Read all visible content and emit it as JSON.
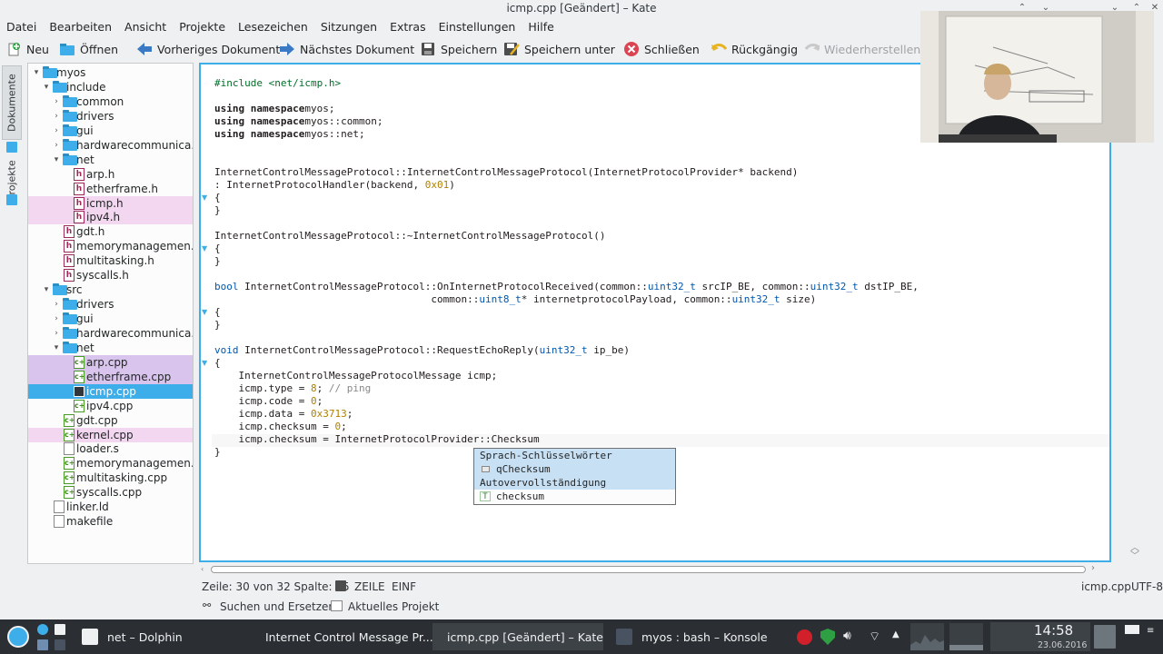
{
  "window": {
    "title": "icmp.cpp [Geändert] – Kate"
  },
  "menu": [
    "Datei",
    "Bearbeiten",
    "Ansicht",
    "Projekte",
    "Lesezeichen",
    "Sitzungen",
    "Extras",
    "Einstellungen",
    "Hilfe"
  ],
  "toolbar": {
    "new": "Neu",
    "open": "Öffnen",
    "prev_doc": "Vorheriges Dokument",
    "next_doc": "Nächstes Dokument",
    "save": "Speichern",
    "save_as": "Speichern unter",
    "close": "Schließen",
    "undo": "Rückgängig",
    "redo": "Wiederherstellen"
  },
  "side_tabs": {
    "documents": "Dokumente",
    "projects": "Projekte"
  },
  "tree": [
    {
      "label": "myos",
      "depth": 0,
      "type": "folder",
      "expanded": true
    },
    {
      "label": "include",
      "depth": 1,
      "type": "folder",
      "expanded": true
    },
    {
      "label": "common",
      "depth": 2,
      "type": "folder",
      "expanded": false
    },
    {
      "label": "drivers",
      "depth": 2,
      "type": "folder",
      "expanded": false
    },
    {
      "label": "gui",
      "depth": 2,
      "type": "folder",
      "expanded": false
    },
    {
      "label": "hardwarecommunica...",
      "depth": 2,
      "type": "folder",
      "expanded": false
    },
    {
      "label": "net",
      "depth": 2,
      "type": "folder",
      "expanded": true
    },
    {
      "label": "arp.h",
      "depth": 3,
      "type": "h",
      "hl": ""
    },
    {
      "label": "etherframe.h",
      "depth": 3,
      "type": "h",
      "hl": ""
    },
    {
      "label": "icmp.h",
      "depth": 3,
      "type": "h",
      "hl": "pink"
    },
    {
      "label": "ipv4.h",
      "depth": 3,
      "type": "h",
      "hl": "pink"
    },
    {
      "label": "gdt.h",
      "depth": 2,
      "type": "h",
      "hl": ""
    },
    {
      "label": "memorymanagemen...",
      "depth": 2,
      "type": "h",
      "hl": ""
    },
    {
      "label": "multitasking.h",
      "depth": 2,
      "type": "h",
      "hl": ""
    },
    {
      "label": "syscalls.h",
      "depth": 2,
      "type": "h",
      "hl": ""
    },
    {
      "label": "src",
      "depth": 1,
      "type": "folder",
      "expanded": true
    },
    {
      "label": "drivers",
      "depth": 2,
      "type": "folder",
      "expanded": false
    },
    {
      "label": "gui",
      "depth": 2,
      "type": "folder",
      "expanded": false
    },
    {
      "label": "hardwarecommunica...",
      "depth": 2,
      "type": "folder",
      "expanded": false
    },
    {
      "label": "net",
      "depth": 2,
      "type": "folder",
      "expanded": true
    },
    {
      "label": "arp.cpp",
      "depth": 3,
      "type": "cpp",
      "hl": "purple"
    },
    {
      "label": "etherframe.cpp",
      "depth": 3,
      "type": "cpp",
      "hl": "purple"
    },
    {
      "label": "icmp.cpp",
      "depth": 3,
      "type": "save",
      "hl": "selected"
    },
    {
      "label": "ipv4.cpp",
      "depth": 3,
      "type": "cpp",
      "hl": ""
    },
    {
      "label": "gdt.cpp",
      "depth": 2,
      "type": "cpp",
      "hl": ""
    },
    {
      "label": "kernel.cpp",
      "depth": 2,
      "type": "cpp",
      "hl": "pink"
    },
    {
      "label": "loader.s",
      "depth": 2,
      "type": "plain",
      "hl": ""
    },
    {
      "label": "memorymanagemen...",
      "depth": 2,
      "type": "cpp",
      "hl": ""
    },
    {
      "label": "multitasking.cpp",
      "depth": 2,
      "type": "cpp",
      "hl": ""
    },
    {
      "label": "syscalls.cpp",
      "depth": 2,
      "type": "cpp",
      "hl": ""
    },
    {
      "label": "linker.ld",
      "depth": 1,
      "type": "plain",
      "hl": ""
    },
    {
      "label": "makefile",
      "depth": 1,
      "type": "plain",
      "hl": ""
    }
  ],
  "code": [
    [
      [
        "pp",
        "#include <net/icmp.h>"
      ]
    ],
    [],
    [
      [
        "kw",
        "using namespace"
      ],
      [
        "",
        "myos;"
      ]
    ],
    [
      [
        "kw",
        "using namespace"
      ],
      [
        "",
        "myos::common;"
      ]
    ],
    [
      [
        "kw",
        "using namespace"
      ],
      [
        "",
        "myos::net;"
      ]
    ],
    [],
    [],
    [
      [
        "",
        "InternetControlMessageProtocol::InternetControlMessageProtocol(InternetProtocolProvider* backend)"
      ]
    ],
    [
      [
        "",
        ": InternetProtocolHandler(backend, "
      ],
      [
        "num",
        "0x01"
      ],
      [
        "",
        ")"
      ]
    ],
    [
      [
        "",
        "{"
      ]
    ],
    [
      [
        "",
        "}"
      ]
    ],
    [],
    [
      [
        "",
        "InternetControlMessageProtocol::~InternetControlMessageProtocol()"
      ]
    ],
    [
      [
        "",
        "{"
      ]
    ],
    [
      [
        "",
        "}"
      ]
    ],
    [],
    [
      [
        "ty",
        "bool"
      ],
      [
        "",
        " InternetControlMessageProtocol::OnInternetProtocolReceived(common::"
      ],
      [
        "ty",
        "uint32_t"
      ],
      [
        "",
        " srcIP_BE, common::"
      ],
      [
        "ty",
        "uint32_t"
      ],
      [
        "",
        " dstIP_BE,"
      ]
    ],
    [
      [
        "",
        "                                    common::"
      ],
      [
        "ty",
        "uint8_t"
      ],
      [
        "",
        "* internetprotocolPayload, common::"
      ],
      [
        "ty",
        "uint32_t"
      ],
      [
        "",
        " size)"
      ]
    ],
    [
      [
        "",
        "{"
      ]
    ],
    [
      [
        "",
        "}"
      ]
    ],
    [],
    [
      [
        "ty",
        "void"
      ],
      [
        "",
        " InternetControlMessageProtocol::RequestEchoReply("
      ],
      [
        "ty",
        "uint32_t"
      ],
      [
        "",
        " ip_be)"
      ]
    ],
    [
      [
        "",
        "{"
      ]
    ],
    [
      [
        "",
        "    InternetControlMessageProtocolMessage icmp;"
      ]
    ],
    [
      [
        "",
        "    icmp.type = "
      ],
      [
        "num",
        "8"
      ],
      [
        "",
        "; "
      ],
      [
        "cm",
        "// ping"
      ]
    ],
    [
      [
        "",
        "    icmp.code = "
      ],
      [
        "num",
        "0"
      ],
      [
        "",
        ";"
      ]
    ],
    [
      [
        "",
        "    icmp.data = "
      ],
      [
        "num",
        "0x3713"
      ],
      [
        "",
        ";"
      ]
    ],
    [
      [
        "",
        "    icmp.checksum = "
      ],
      [
        "num",
        "0"
      ],
      [
        "",
        ";"
      ]
    ],
    [
      [
        "",
        "    icmp.checksum = InternetProtocolProvider::Checksum"
      ]
    ],
    [
      [
        "",
        "}"
      ]
    ]
  ],
  "completion": {
    "group1": "Sprach-Schlüsselwörter",
    "item1": "qChecksum",
    "group2": "Autovervollständigung",
    "item2": "checksum"
  },
  "status": {
    "position": "Zeile: 30 von 32 Spalte: 55",
    "mode": "ZEILE",
    "insert": "EINF",
    "filename": "icmp.cpp",
    "encoding": "UTF-8"
  },
  "bottom_tabs": {
    "search": "Suchen und Ersetzen",
    "project": "Aktuelles Projekt"
  },
  "taskbar": {
    "tasks": [
      "net – Dolphin",
      "Internet Control Message Pr...",
      "icmp.cpp [Geändert] – Kate",
      "myos : bash – Konsole"
    ],
    "time": "14:58",
    "date": "23.06.2016"
  },
  "colors": {
    "accent": "#3daee9",
    "hl_pink": "#f3d6f0",
    "hl_purple": "#d9c4ee",
    "selected": "#3daee9"
  }
}
